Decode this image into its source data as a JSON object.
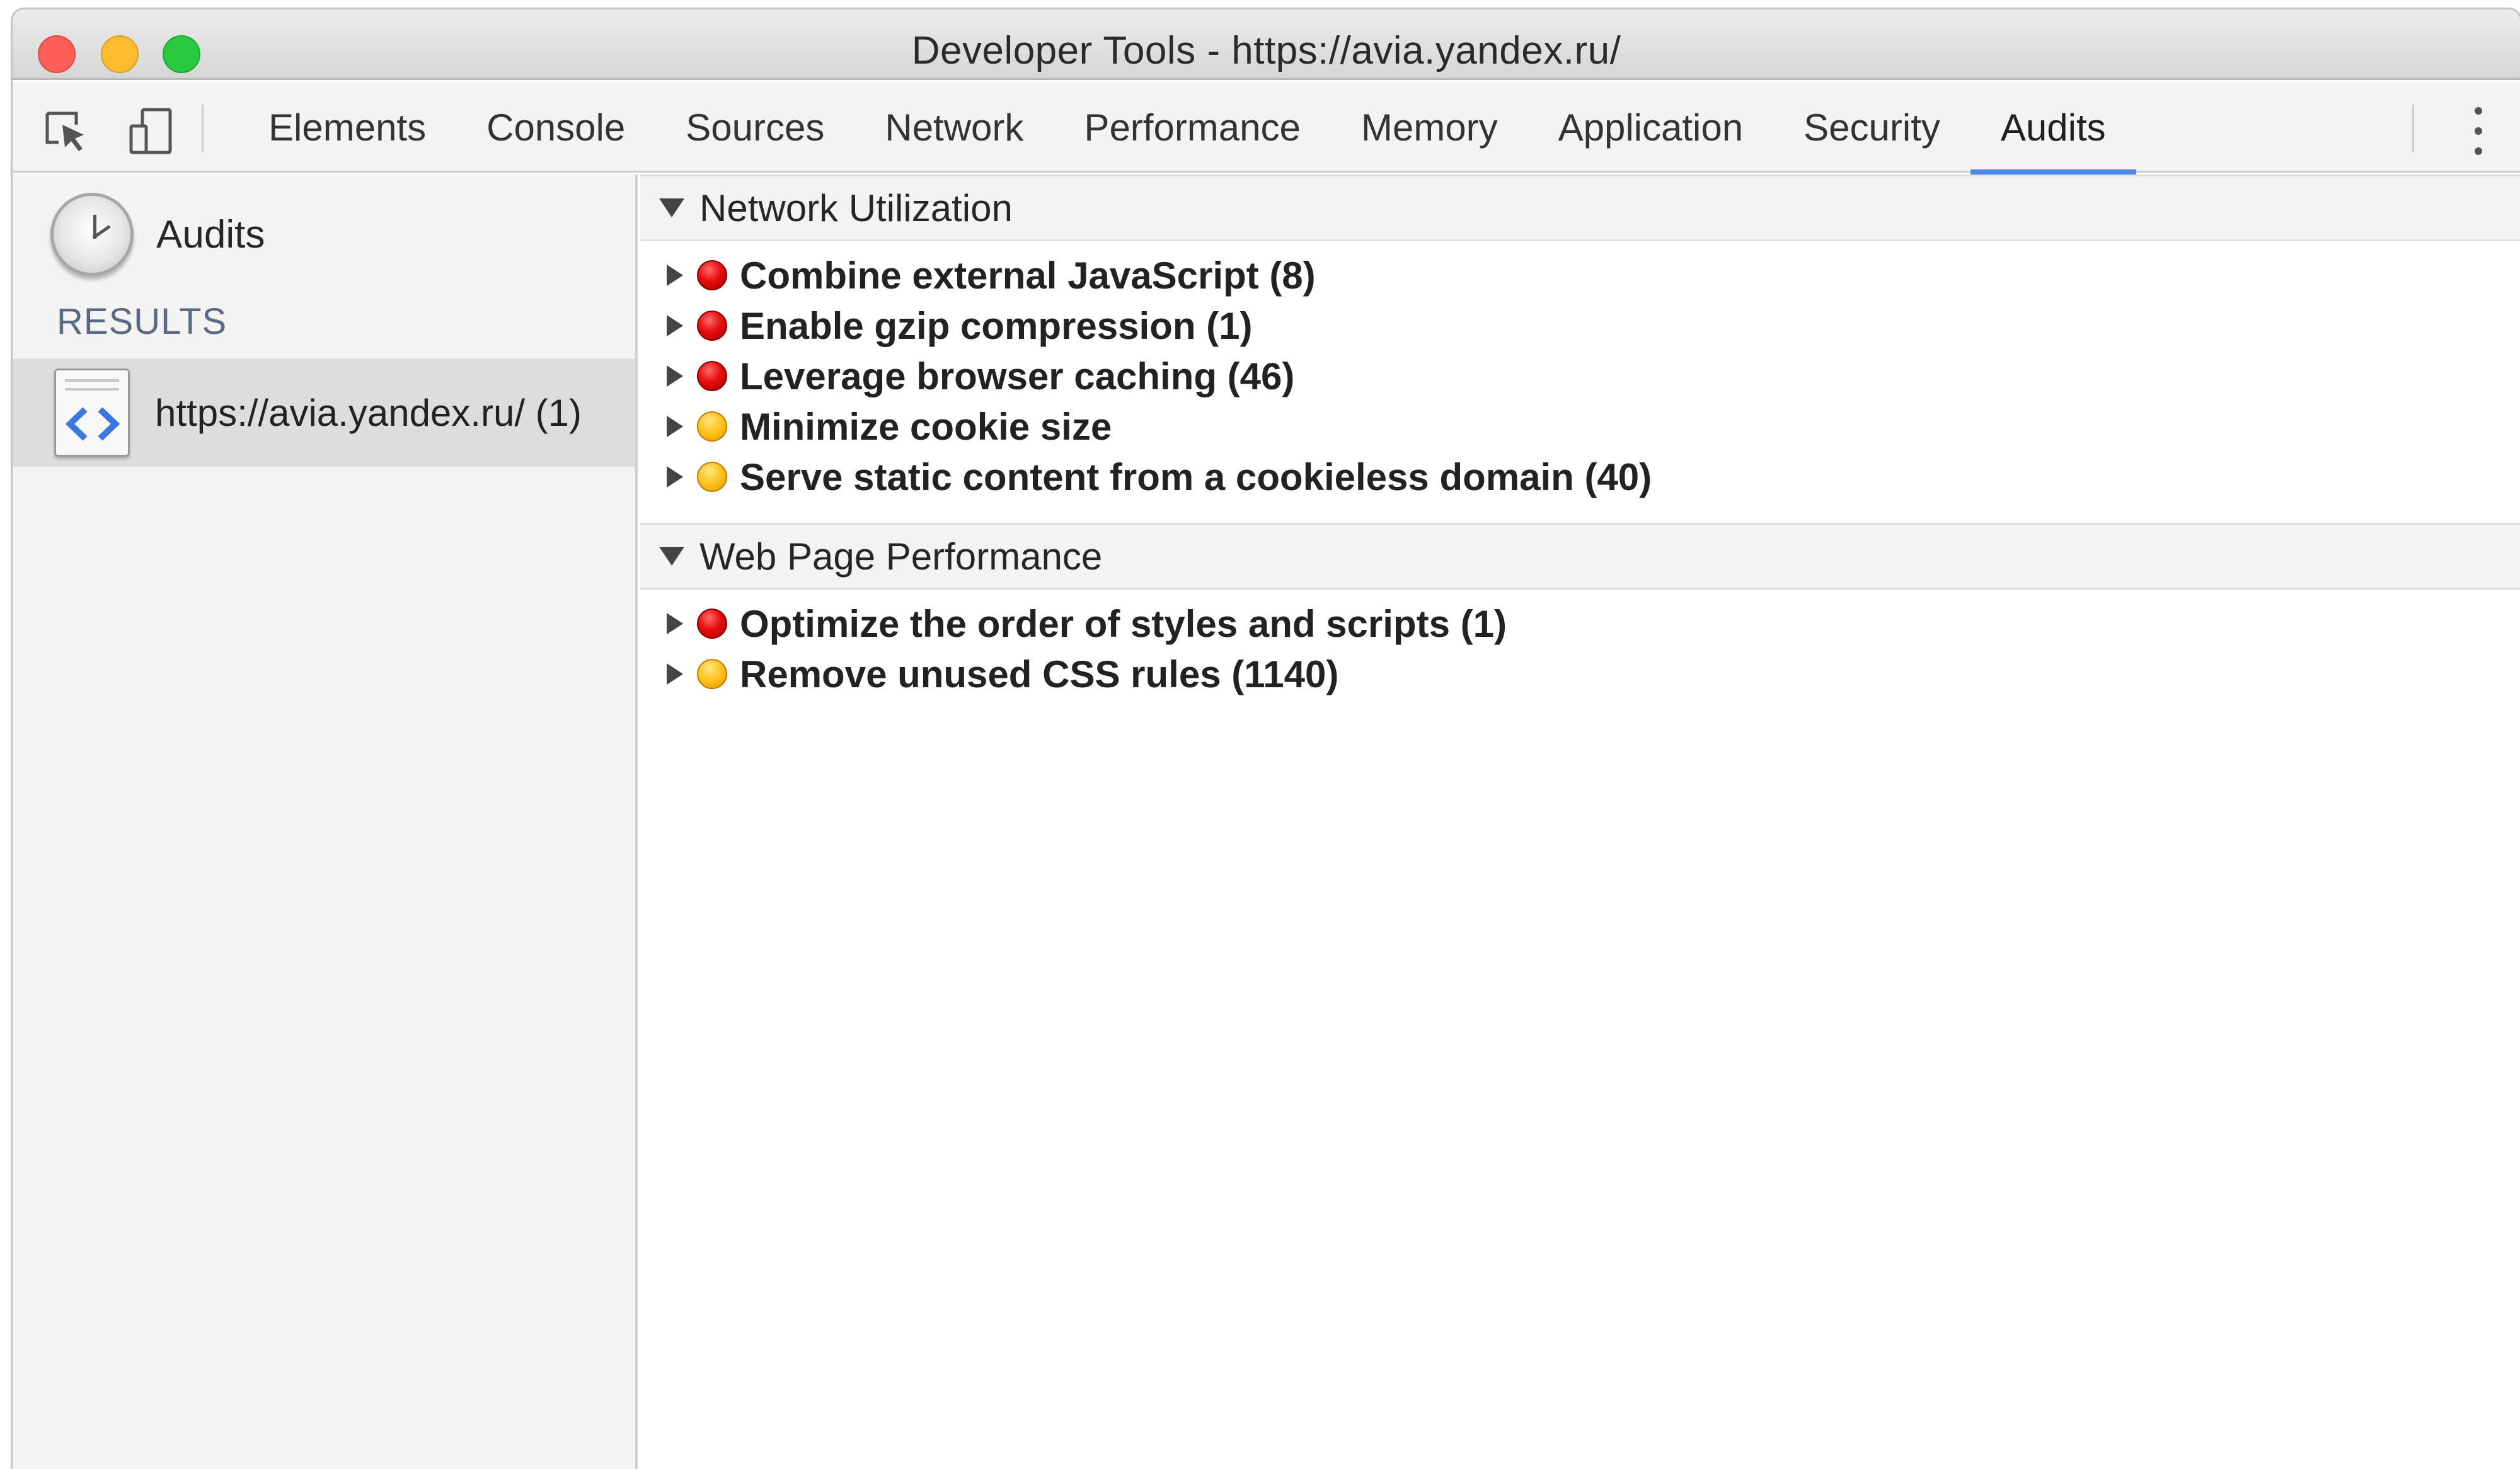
{
  "window": {
    "title": "Developer Tools - https://avia.yandex.ru/"
  },
  "toolbar": {
    "tabs": [
      {
        "label": "Elements",
        "active": false
      },
      {
        "label": "Console",
        "active": false
      },
      {
        "label": "Sources",
        "active": false
      },
      {
        "label": "Network",
        "active": false
      },
      {
        "label": "Performance",
        "active": false
      },
      {
        "label": "Memory",
        "active": false
      },
      {
        "label": "Application",
        "active": false
      },
      {
        "label": "Security",
        "active": false
      },
      {
        "label": "Audits",
        "active": true
      }
    ],
    "icons": [
      "inspect-element-icon",
      "device-toolbar-icon",
      "more-options-icon"
    ],
    "accent_color": "#4e86e8"
  },
  "sidebar": {
    "audits_label": "Audits",
    "results_label": "RESULTS",
    "result_item": "https://avia.yandex.ru/ (1)"
  },
  "main": {
    "sections": [
      {
        "title": "Network Utilization",
        "rows": [
          {
            "label": "Combine external JavaScript (8)",
            "severity": "red"
          },
          {
            "label": "Enable gzip compression (1)",
            "severity": "red"
          },
          {
            "label": "Leverage browser caching (46)",
            "severity": "red"
          },
          {
            "label": "Minimize cookie size",
            "severity": "yellow"
          },
          {
            "label": "Serve static content from a cookieless domain (40)",
            "severity": "yellow"
          }
        ]
      },
      {
        "title": "Web Page Performance",
        "rows": [
          {
            "label": "Optimize the order of styles and scripts (1)",
            "severity": "red"
          },
          {
            "label": "Remove unused CSS rules (1140)",
            "severity": "yellow"
          }
        ]
      }
    ],
    "severity_colors": {
      "red": "#e60d0d",
      "yellow": "#ffc21a"
    }
  }
}
